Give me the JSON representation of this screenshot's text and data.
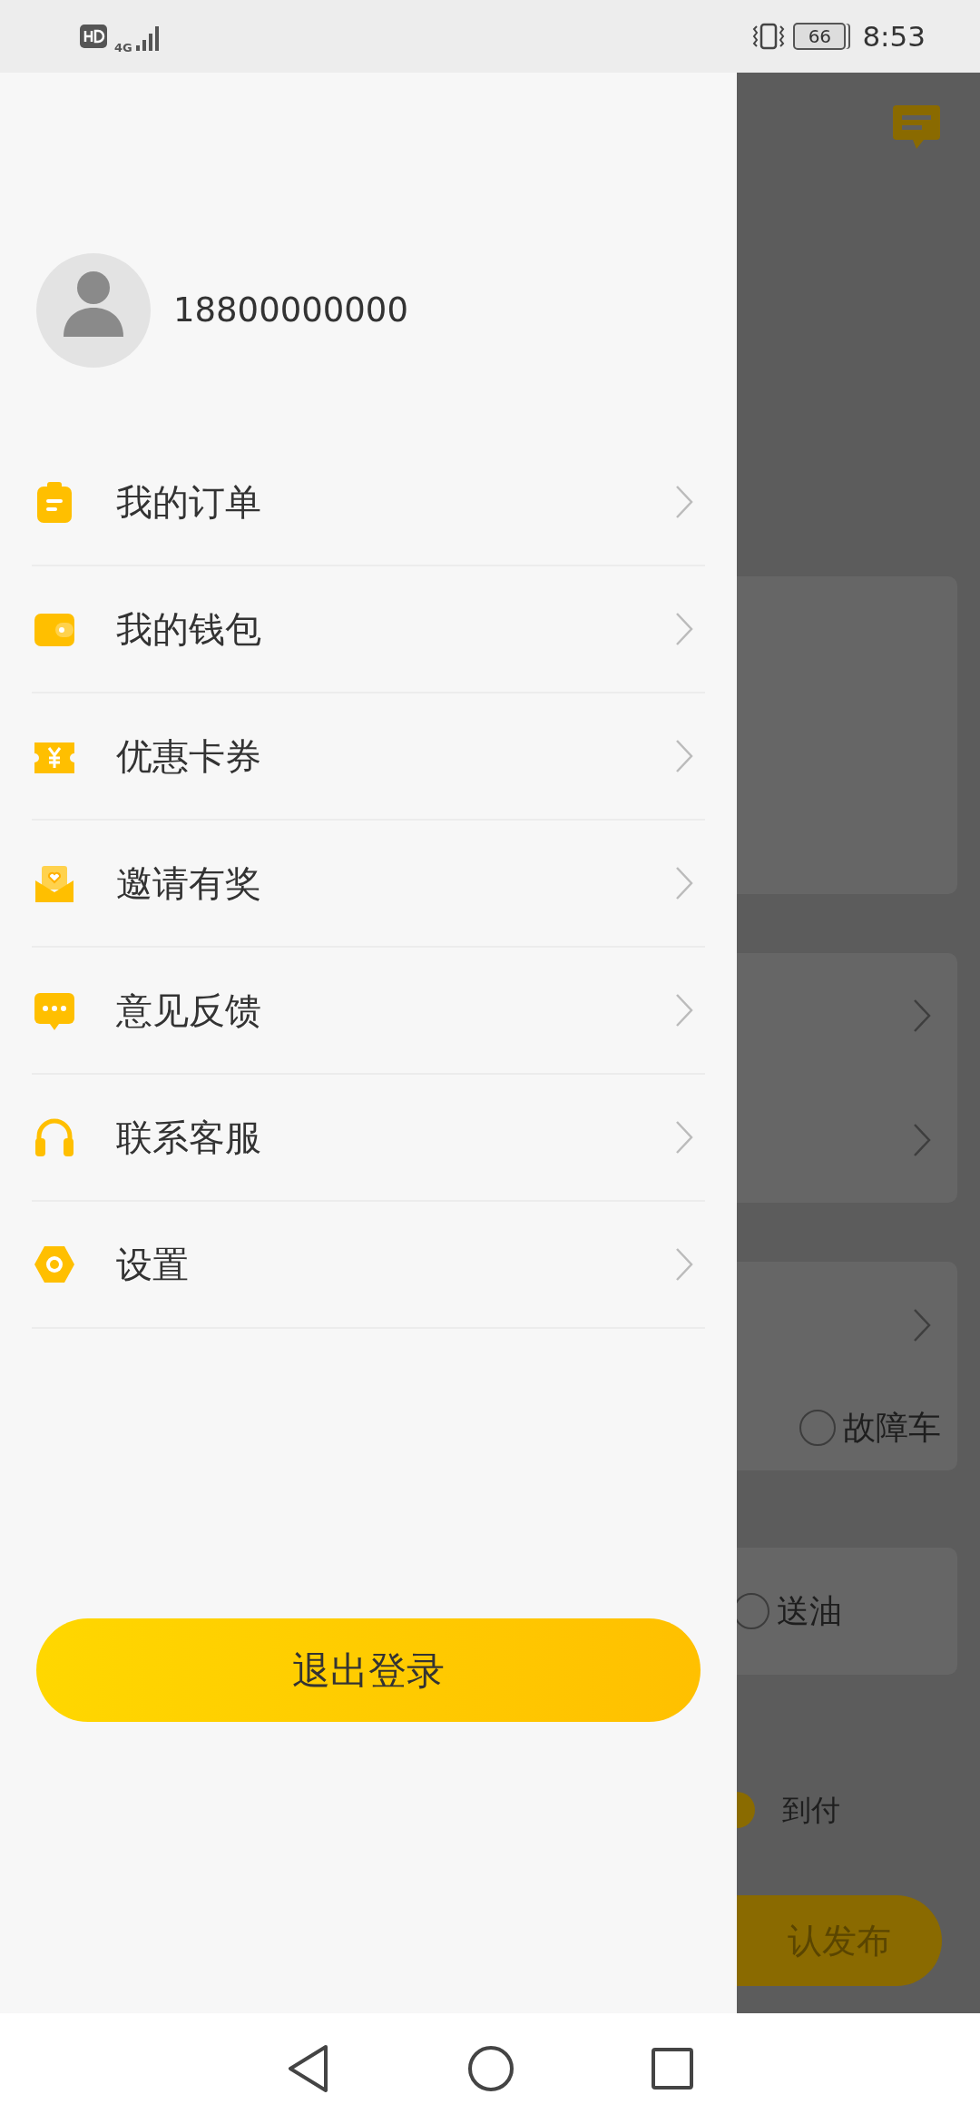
{
  "status_bar": {
    "network": "4G",
    "battery": "66",
    "time": "8:53"
  },
  "drawer": {
    "phone": "18800000000",
    "menu": [
      {
        "label": "我的订单",
        "kind": "orders"
      },
      {
        "label": "我的钱包",
        "kind": "wallet"
      },
      {
        "label": "优惠卡券",
        "kind": "coupon"
      },
      {
        "label": "邀请有奖",
        "kind": "invite"
      },
      {
        "label": "意见反馈",
        "kind": "feedback"
      },
      {
        "label": "联系客服",
        "kind": "service"
      },
      {
        "label": "设置",
        "kind": "settings"
      }
    ],
    "logout": "退出登录"
  },
  "background_page": {
    "options": [
      {
        "label": "故障车",
        "selected": false
      },
      {
        "label": "送油",
        "selected": false
      },
      {
        "label": "到付",
        "selected": true
      }
    ],
    "confirm": "认发布"
  }
}
